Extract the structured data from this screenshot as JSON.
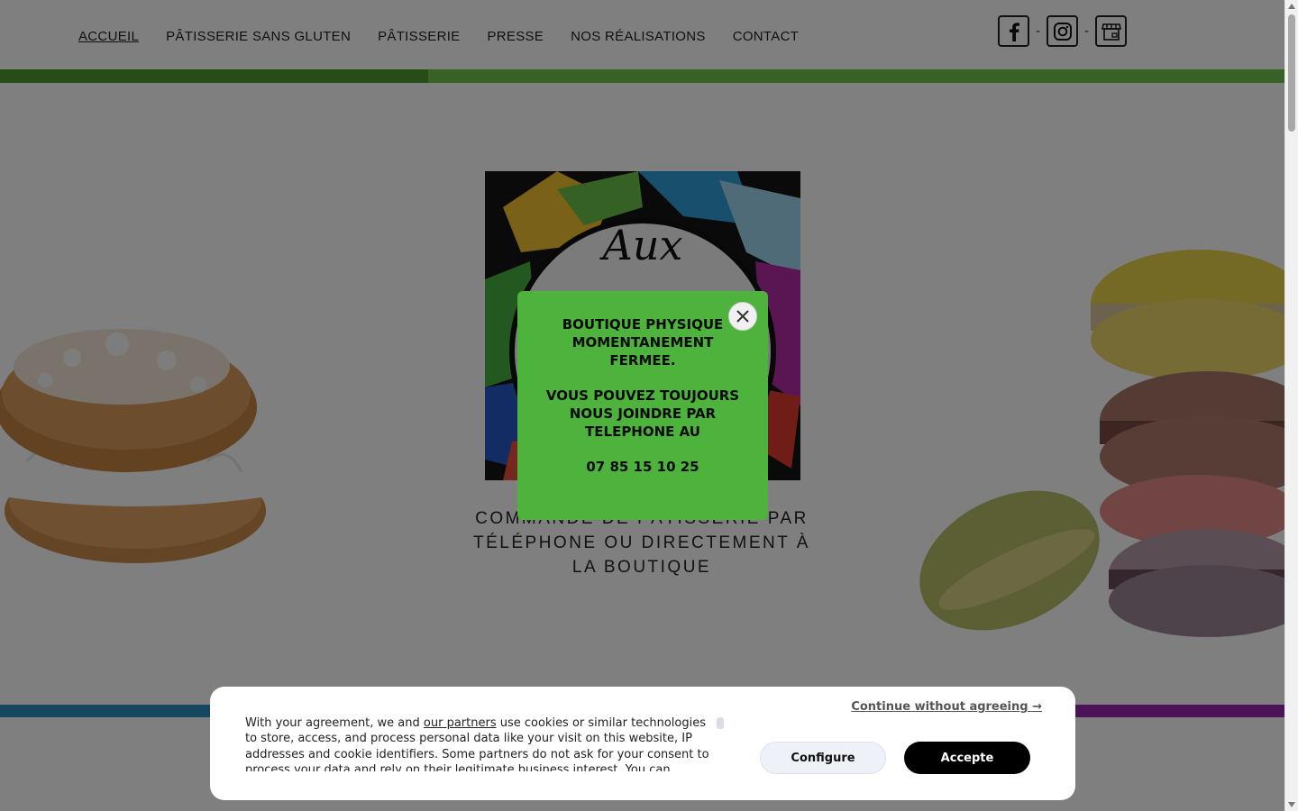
{
  "nav": {
    "items": [
      {
        "label": "ACCUEIL",
        "active": true
      },
      {
        "label": "PÂTISSERIE SANS GLUTEN",
        "active": false
      },
      {
        "label": "PÂTISSERIE",
        "active": false
      },
      {
        "label": "PRESSE",
        "active": false
      },
      {
        "label": "NOS RÉALISATIONS",
        "active": false
      },
      {
        "label": "CONTACT",
        "active": false
      }
    ]
  },
  "social": {
    "separator": "-",
    "icons": [
      "facebook-icon",
      "instagram-icon",
      "store-icon"
    ]
  },
  "colors": {
    "bar_green_dark": "#4c9a30",
    "bar_green_light": "#6fc24a",
    "bar_blue": "#2b8fc2",
    "bar_purple": "#9b27b0",
    "popup_bg": "#4db33d",
    "accept_bg": "#000000"
  },
  "hero": {
    "logo_script": "Aux",
    "tagline": "COMMANDE DE PÂTISSERIE PAR TÉLÉPHONE OU DIRECTEMENT À LA BOUTIQUE"
  },
  "popup": {
    "line1": "BOUTIQUE PHYSIQUE MOMENTANEMENT FERMEE.",
    "line2": "VOUS POUVEZ TOUJOURS NOUS JOINDRE PAR TELEPHONE AU",
    "phone": "07 85 15 10 25"
  },
  "cookie": {
    "text_before_link": "With your agreement, we and ",
    "link_label": "our partners",
    "text_after_link": " use cookies or similar technologies to store, access, and process personal data like your visit on this website, IP addresses and cookie identifiers. Some partners do not ask for your consent to process your data and rely on their legitimate business interest. You can",
    "continue_label": "Continue without agreeing →",
    "configure_label": "Configure",
    "accept_label": "Accepte"
  }
}
